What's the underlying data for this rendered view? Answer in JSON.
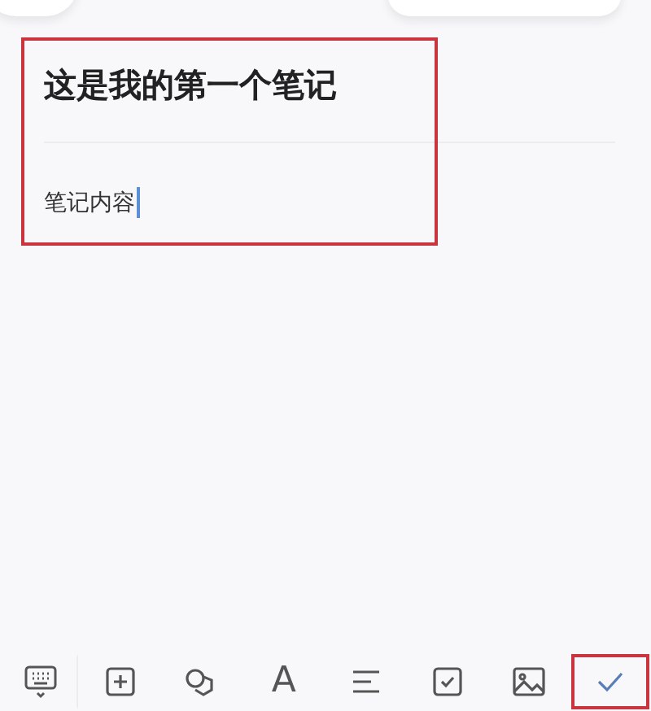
{
  "note": {
    "title": "这是我的第一个笔记",
    "body": "笔记内容",
    "highlighted": true
  },
  "toolbar": [
    {
      "kind": "keyboard",
      "highlighted": false
    },
    {
      "kind": "add",
      "highlighted": false
    },
    {
      "kind": "shapes",
      "highlighted": false
    },
    {
      "kind": "text",
      "label": "A",
      "highlighted": false
    },
    {
      "kind": "align",
      "highlighted": false
    },
    {
      "kind": "checklist",
      "highlighted": false
    },
    {
      "kind": "image",
      "highlighted": false
    },
    {
      "kind": "done",
      "highlighted": true
    }
  ]
}
